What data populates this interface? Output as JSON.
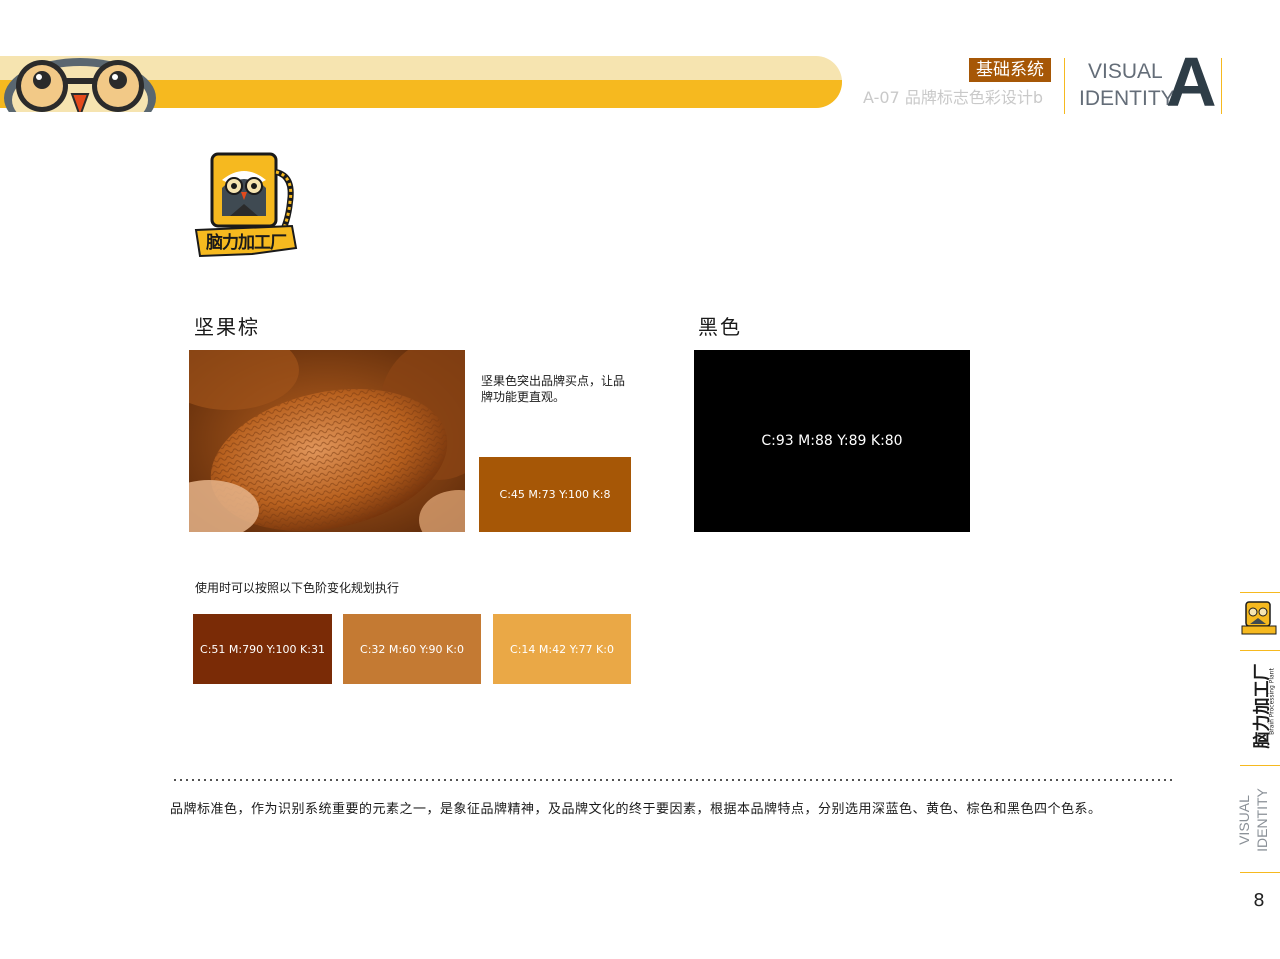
{
  "header": {
    "section_tag": "基础系统",
    "page_subtitle": "A-07  品牌标志色彩设计b",
    "visual": "VISUAL",
    "identity": "IDENTITY",
    "letter": "A"
  },
  "logo": {
    "wordmark": "脑力加工厂",
    "icon": "owl-mascot-icon"
  },
  "brown_section": {
    "title": "坚果棕",
    "description": "坚果色突出品牌买点，让品牌功能更直观。",
    "main_swatch": {
      "label": "C:45 M:73 Y:100 K:8",
      "color": "#a65706"
    },
    "photo": "almond-photo"
  },
  "black_section": {
    "title": "黑色",
    "swatch": {
      "label": "C:93 M:88 Y:89 K:80",
      "color": "#000000"
    }
  },
  "gradient": {
    "note": "使用时可以按照以下色阶变化规划执行",
    "swatches": [
      {
        "label": "C:51 M:790 Y:100 K:31",
        "color": "#7a2b06"
      },
      {
        "label": "C:32 M:60 Y:90 K:0",
        "color": "#c47a33"
      },
      {
        "label": "C:14 M:42 Y:77 K:0",
        "color": "#eaa846"
      }
    ]
  },
  "footer": {
    "text": "品牌标准色，作为识别系统重要的元素之一，是象征品牌精神，及品牌文化的终于要因素，根据本品牌特点，分别选用深蓝色、黄色、棕色和黑色四个色系。"
  },
  "sidebar": {
    "brand_cn": "脑力加工厂",
    "brand_en": "Brain Processing Plant",
    "visual": "VISUAL",
    "identity": "IDENTITY",
    "page_number": "8"
  },
  "colors": {
    "accent_yellow": "#f6b91f",
    "light_yellow": "#f6e4b0",
    "brown": "#a65706",
    "navy": "#2e3d47"
  }
}
